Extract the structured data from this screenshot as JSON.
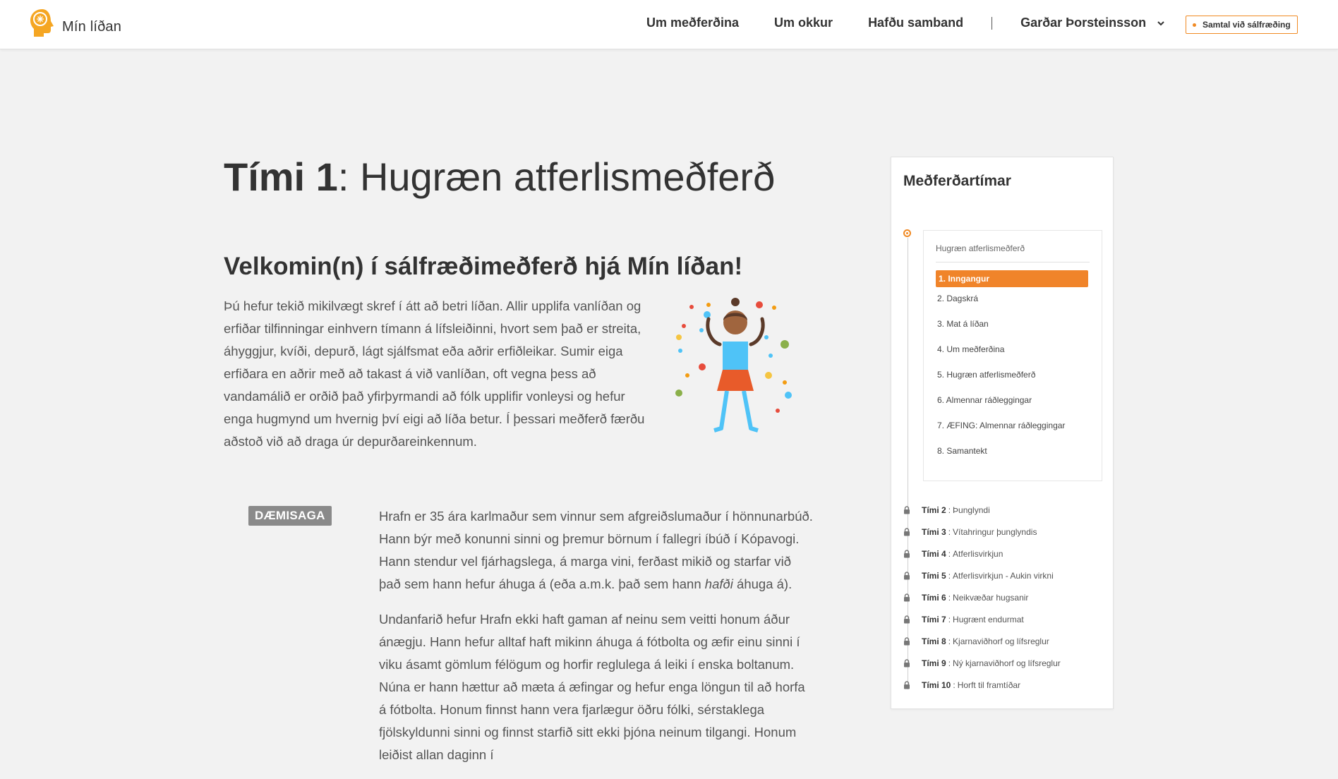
{
  "header": {
    "logo_text": "Mín líðan",
    "nav": [
      "Um meðferðina",
      "Um okkur",
      "Hafðu samband"
    ],
    "separator": "|",
    "user_name": "Garðar Þorsteinsson",
    "cta_label": "Samtal við sálfræðing",
    "accent_color": "#f08a24"
  },
  "main": {
    "title_number": "Tími 1",
    "title_rest": ": Hugræn atferlismeðferð",
    "welcome_heading": "Velkomin(n) í sálfræðimeðferð hjá Mín líðan!",
    "intro": "Þú hefur tekið mikilvægt skref í átt að betri líðan. Allir upplifa vanlíðan og erfiðar tilfinningar einhvern tímann á lífsleiðinni, hvort sem það er streita, áhyggjur, kvíði, depurð, lágt sjálfsmat eða aðrir erfiðleikar. Sumir eiga erfiðara en aðrir með að takast á við vanlíðan, oft vegna þess að vandamálið er orðið það yfirþyrmandi að fólk upplifir vonleysi og hefur enga hugmynd um hvernig því eigi að líða betur. Í þessari meðferð færðu aðstoð við að draga úr depurðareinkennum.",
    "badge": "DÆMISAGA",
    "story_p1_before": "Hrafn er 35 ára karlmaður sem vinnur sem afgreiðslumaður í hönnunarbúð. Hann býr með konunni sinni og þremur börnum í fallegri íbúð í Kópavogi. Hann stendur vel fjárhagslega, á marga vini, ferðast mikið og starfar við það sem hann hefur áhuga á (eða a.m.k. það sem hann ",
    "story_p1_em": "hafði",
    "story_p1_after": " áhuga á).",
    "story_p2": "Undanfarið hefur Hrafn ekki haft gaman af neinu sem veitti honum áður ánægju. Hann hefur alltaf haft mikinn áhuga á fótbolta og æfir einu sinni í viku ásamt gömlum félögum og horfir reglulega á leiki í enska boltanum. Núna er hann hættur að mæta á æfingar og hefur enga löngun til að horfa á fótbolta. Honum finnst hann vera fjarlægur öðru fólki, sérstaklega fjölskyldunni sinni og finnst starfið sitt ekki þjóna neinum tilgangi. Honum leiðist allan daginn í"
  },
  "sidebar": {
    "title": "Meðferðartímar",
    "current_session": {
      "heading": "Hugræn atferlismeðferð",
      "lessons": [
        "1. Inngangur",
        "2. Dagskrá",
        "3. Mat á líðan",
        "4. Um meðferðina",
        "5. Hugræn atferlismeðferð",
        "6. Almennar ráðleggingar",
        "7. ÆFING: Almennar ráðleggingar",
        "8. Samantekt"
      ],
      "active_index": 0
    },
    "separator": ":",
    "locked_sessions": [
      {
        "number": "Tími 2",
        "name": "Þunglyndi"
      },
      {
        "number": "Tími 3",
        "name": "Vítahringur þunglyndis"
      },
      {
        "number": "Tími 4",
        "name": "Atferlisvirkjun"
      },
      {
        "number": "Tími 5",
        "name": "Atferlisvirkjun - Aukin virkni"
      },
      {
        "number": "Tími 6",
        "name": "Neikvæðar hugsanir"
      },
      {
        "number": "Tími 7",
        "name": "Hugrænt endurmat"
      },
      {
        "number": "Tími 8",
        "name": "Kjarnaviðhorf og lífsreglur"
      },
      {
        "number": "Tími 9",
        "name": "Ný kjarnaviðhorf og lífsreglur"
      },
      {
        "number": "Tími 10",
        "name": "Horft til framtíðar"
      }
    ]
  }
}
